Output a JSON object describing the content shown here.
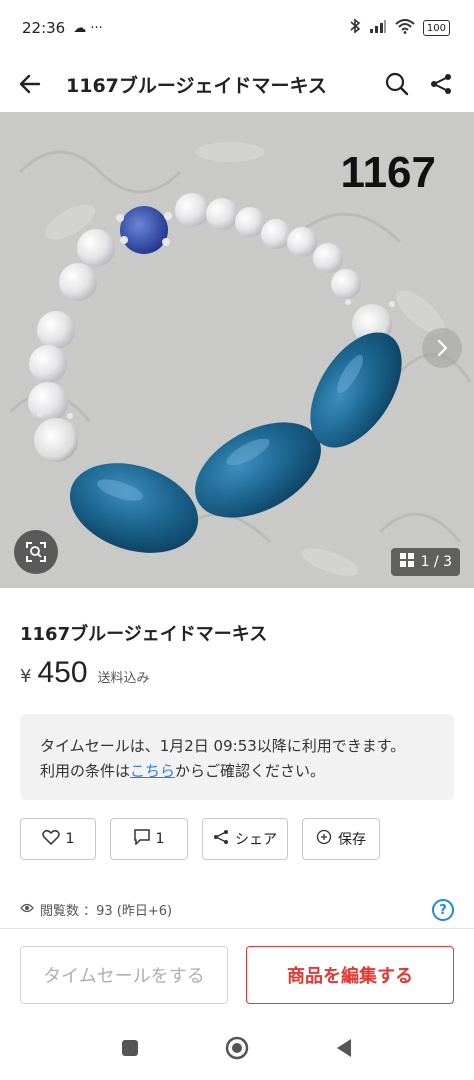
{
  "status_bar": {
    "time": "22:36",
    "extra": "☁ ···",
    "battery": "100"
  },
  "app_bar": {
    "title": "1167ブルージェイドマーキス"
  },
  "image": {
    "overlay_number": "1167",
    "counter": "1 / 3"
  },
  "product": {
    "title": "1167ブルージェイドマーキス",
    "currency": "¥",
    "price": "450",
    "price_note": "送料込み"
  },
  "notice": {
    "line1": "タイムセールは、1月2日 09:53以降に利用できます。",
    "line2_prefix": "利用の条件は",
    "line2_link": "こちら",
    "line2_suffix": "からご確認ください。"
  },
  "actions": {
    "like_count": "1",
    "comment_count": "1",
    "share_label": "シェア",
    "save_label": "保存"
  },
  "views": {
    "text": "閲覧数 ：93 (昨日+6)"
  },
  "bottom": {
    "timesale_label": "タイムセールをする",
    "edit_label": "商品を編集する"
  },
  "colors": {
    "accent_red": "#e53935",
    "link_blue": "#2f7fd8",
    "help_blue": "#1e88e5"
  },
  "icons": [
    "back-arrow-icon",
    "search-icon",
    "share-icon",
    "chevron-right-icon",
    "lens-icon",
    "gallery-icon",
    "heart-icon",
    "comment-icon",
    "save-icon",
    "eye-icon",
    "help-icon"
  ]
}
